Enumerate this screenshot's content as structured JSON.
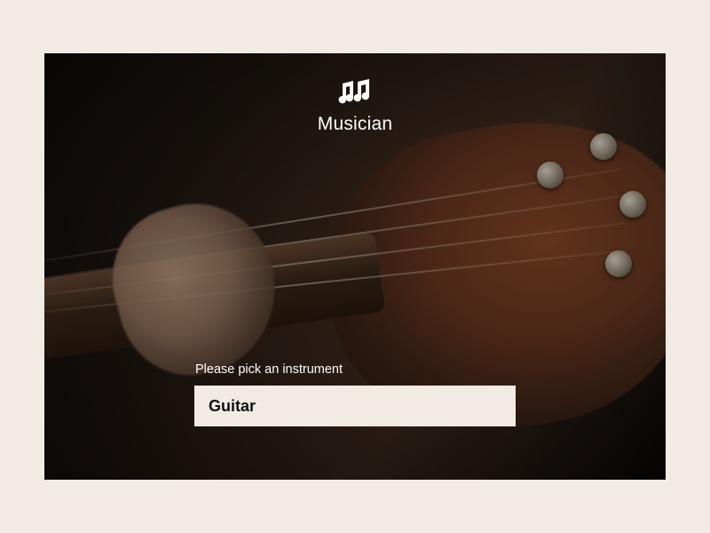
{
  "app": {
    "title": "Musician",
    "icon": "music-notes-icon"
  },
  "picker": {
    "label": "Please pick an instrument",
    "selected": "Guitar"
  },
  "colors": {
    "page_bg": "#f2ebe4",
    "select_bg": "#f2ebe4",
    "text_light": "#ffffff",
    "text_dark": "#111111"
  }
}
